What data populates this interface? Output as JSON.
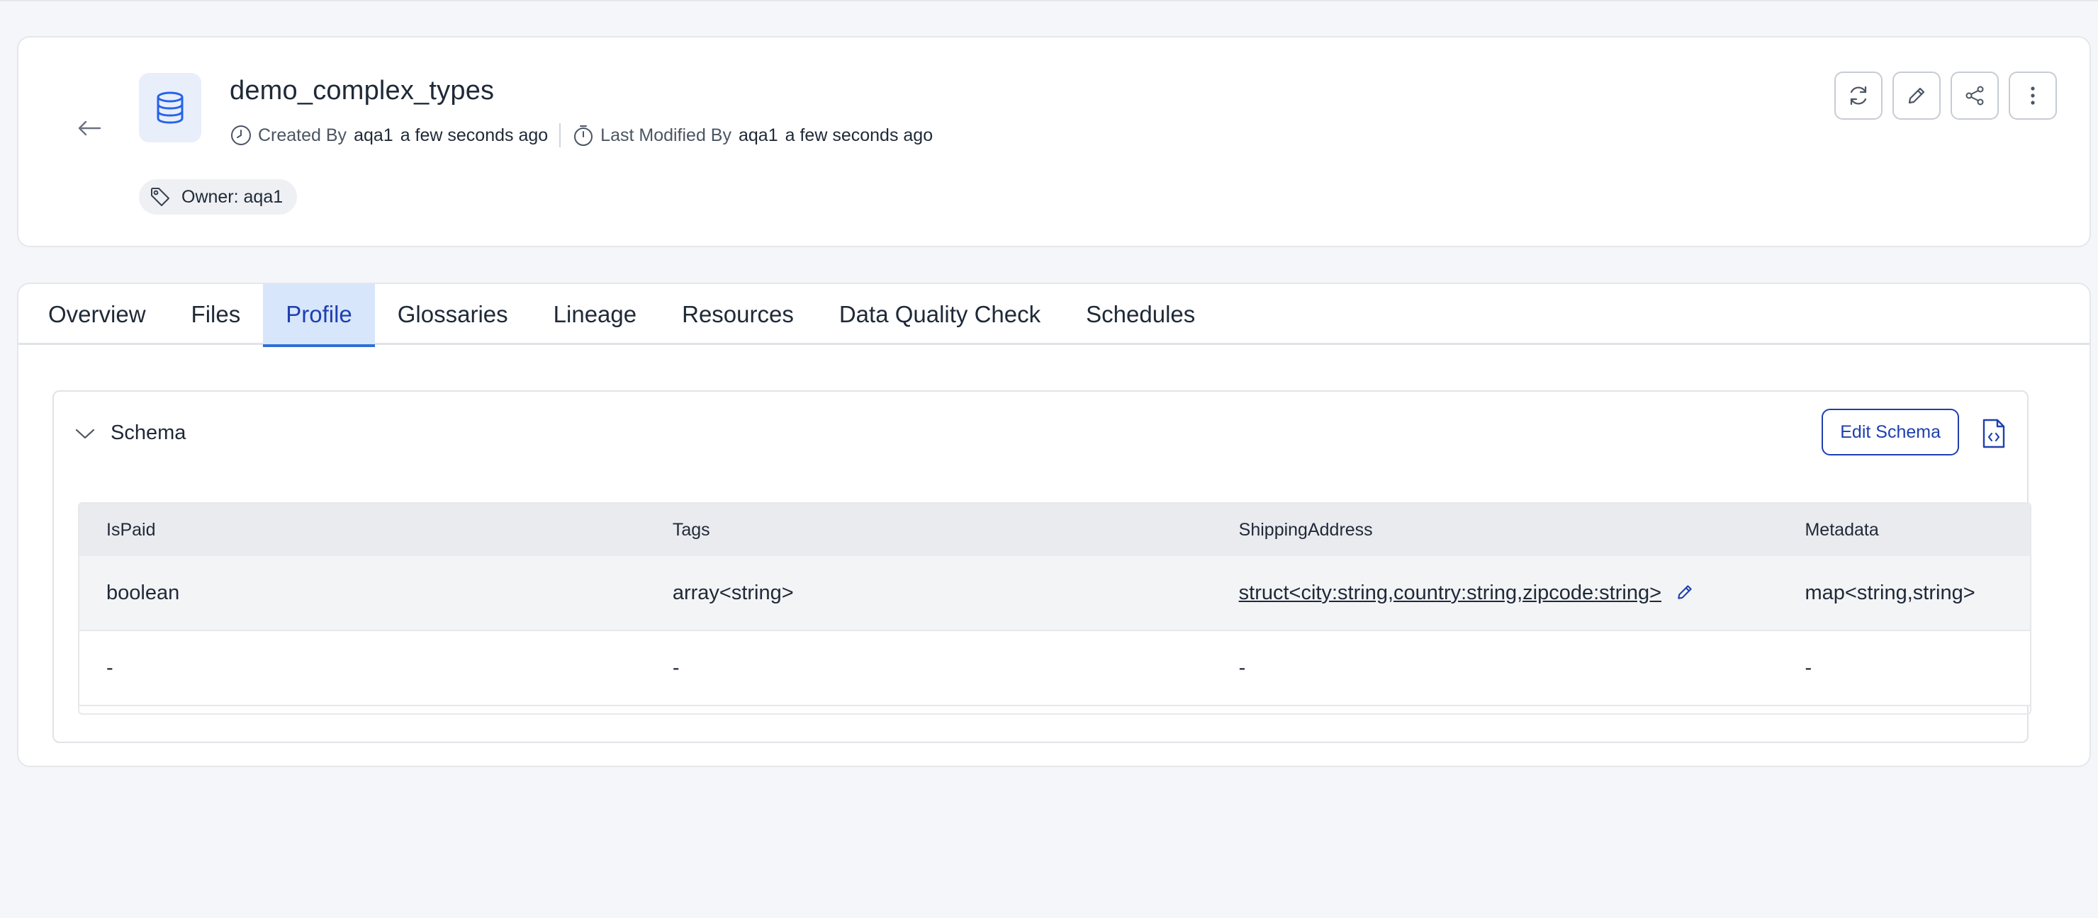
{
  "entity": {
    "title": "demo_complex_types",
    "created_by_label": "Created By",
    "created_by_user": "aqa1",
    "created_time": "a few seconds ago",
    "modified_by_label": "Last Modified By",
    "modified_by_user": "aqa1",
    "modified_time": "a few seconds ago",
    "owner_chip": "Owner: aqa1"
  },
  "actions": [
    "refresh-icon",
    "edit-icon",
    "share-icon",
    "more-vertical-icon"
  ],
  "tabs": [
    {
      "label": "Overview"
    },
    {
      "label": "Files"
    },
    {
      "label": "Profile",
      "active": true
    },
    {
      "label": "Glossaries"
    },
    {
      "label": "Lineage"
    },
    {
      "label": "Resources"
    },
    {
      "label": "Data Quality Check"
    },
    {
      "label": "Schedules"
    }
  ],
  "schema": {
    "title": "Schema",
    "edit_label": "Edit Schema",
    "columns": [
      "IsPaid",
      "Tags",
      "ShippingAddress",
      "Metadata"
    ],
    "rows": [
      [
        "boolean",
        "array<string>",
        "struct<city:string,country:string,zipcode:string>",
        "map<string,string>"
      ],
      [
        "-",
        "-",
        "-",
        "-"
      ]
    ]
  },
  "colors": {
    "accent": "#1e40af",
    "active_tab_bg": "#d8e6fb",
    "icon_blue": "#2563eb"
  }
}
